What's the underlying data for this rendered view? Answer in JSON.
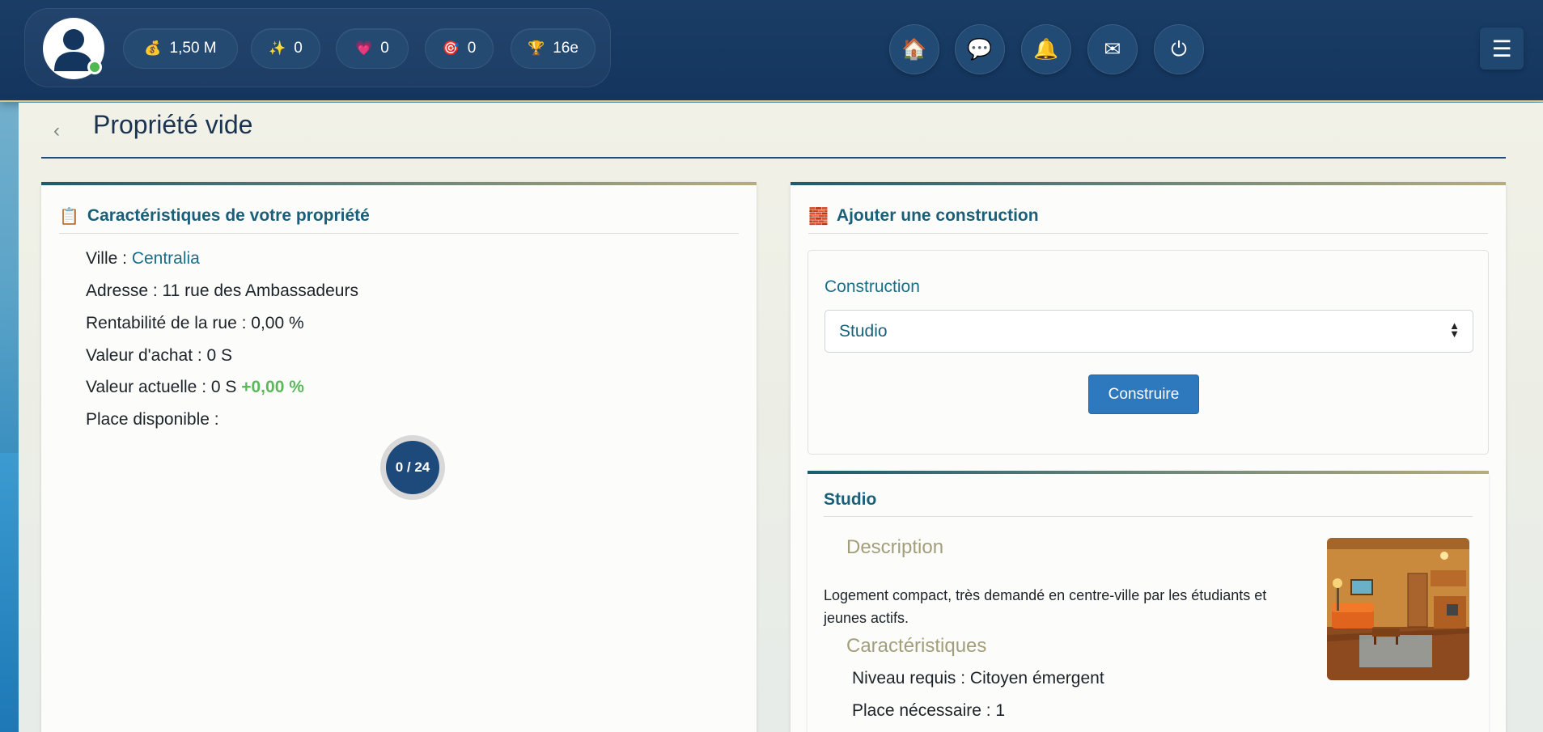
{
  "header": {
    "stats": [
      {
        "icon": "money-bag-icon",
        "glyph": "💰",
        "value": "1,50 M"
      },
      {
        "icon": "sparkles-icon",
        "glyph": "✨",
        "value": "0"
      },
      {
        "icon": "heart-icon",
        "glyph": "💗",
        "value": "0"
      },
      {
        "icon": "target-icon",
        "glyph": "🎯",
        "value": "0"
      },
      {
        "icon": "trophy-icon",
        "glyph": "🏆",
        "value": "16e"
      }
    ],
    "nav": [
      {
        "icon": "home-icon",
        "glyph": "🏠"
      },
      {
        "icon": "chat-icon",
        "glyph": "💬"
      },
      {
        "icon": "bell-icon",
        "glyph": "🔔"
      },
      {
        "icon": "mail-icon",
        "glyph": "✉"
      },
      {
        "icon": "power-icon",
        "glyph": "⏻"
      }
    ],
    "menu_glyph": "☰"
  },
  "page": {
    "back_glyph": "‹",
    "title": "Propriété vide"
  },
  "property": {
    "heading": "Caractéristiques de votre propriété",
    "heading_glyph": "📋",
    "city_label": "Ville : ",
    "city": "Centralia",
    "address": "Adresse : 11 rue des Ambassadeurs",
    "profitability": "Rentabilité de la rue : 0,00 %",
    "purchase_value": "Valeur d'achat : 0 S",
    "current_value_label": "Valeur actuelle : 0 S ",
    "current_value_change": "+0,00 %",
    "space_label": "Place disponible :",
    "space_gauge": "0 / 24",
    "space_used": 0,
    "space_total": 24
  },
  "construction": {
    "heading": "Ajouter une construction",
    "heading_glyph": "🧱",
    "field_label": "Construction",
    "selected": "Studio",
    "button": "Construire"
  },
  "studio": {
    "title": "Studio",
    "description_heading": "Description",
    "description": "Logement compact, très demandé en centre-ville par les étudiants et jeunes actifs.",
    "features_heading": "Caractéristiques",
    "level_required": "Niveau requis : Citoyen émergent",
    "space_needed": "Place nécessaire : 1"
  },
  "colors": {
    "header_bg": "#13355e",
    "accent": "#1a5f7a",
    "button": "#2e78be",
    "positive": "#5cb85c"
  }
}
